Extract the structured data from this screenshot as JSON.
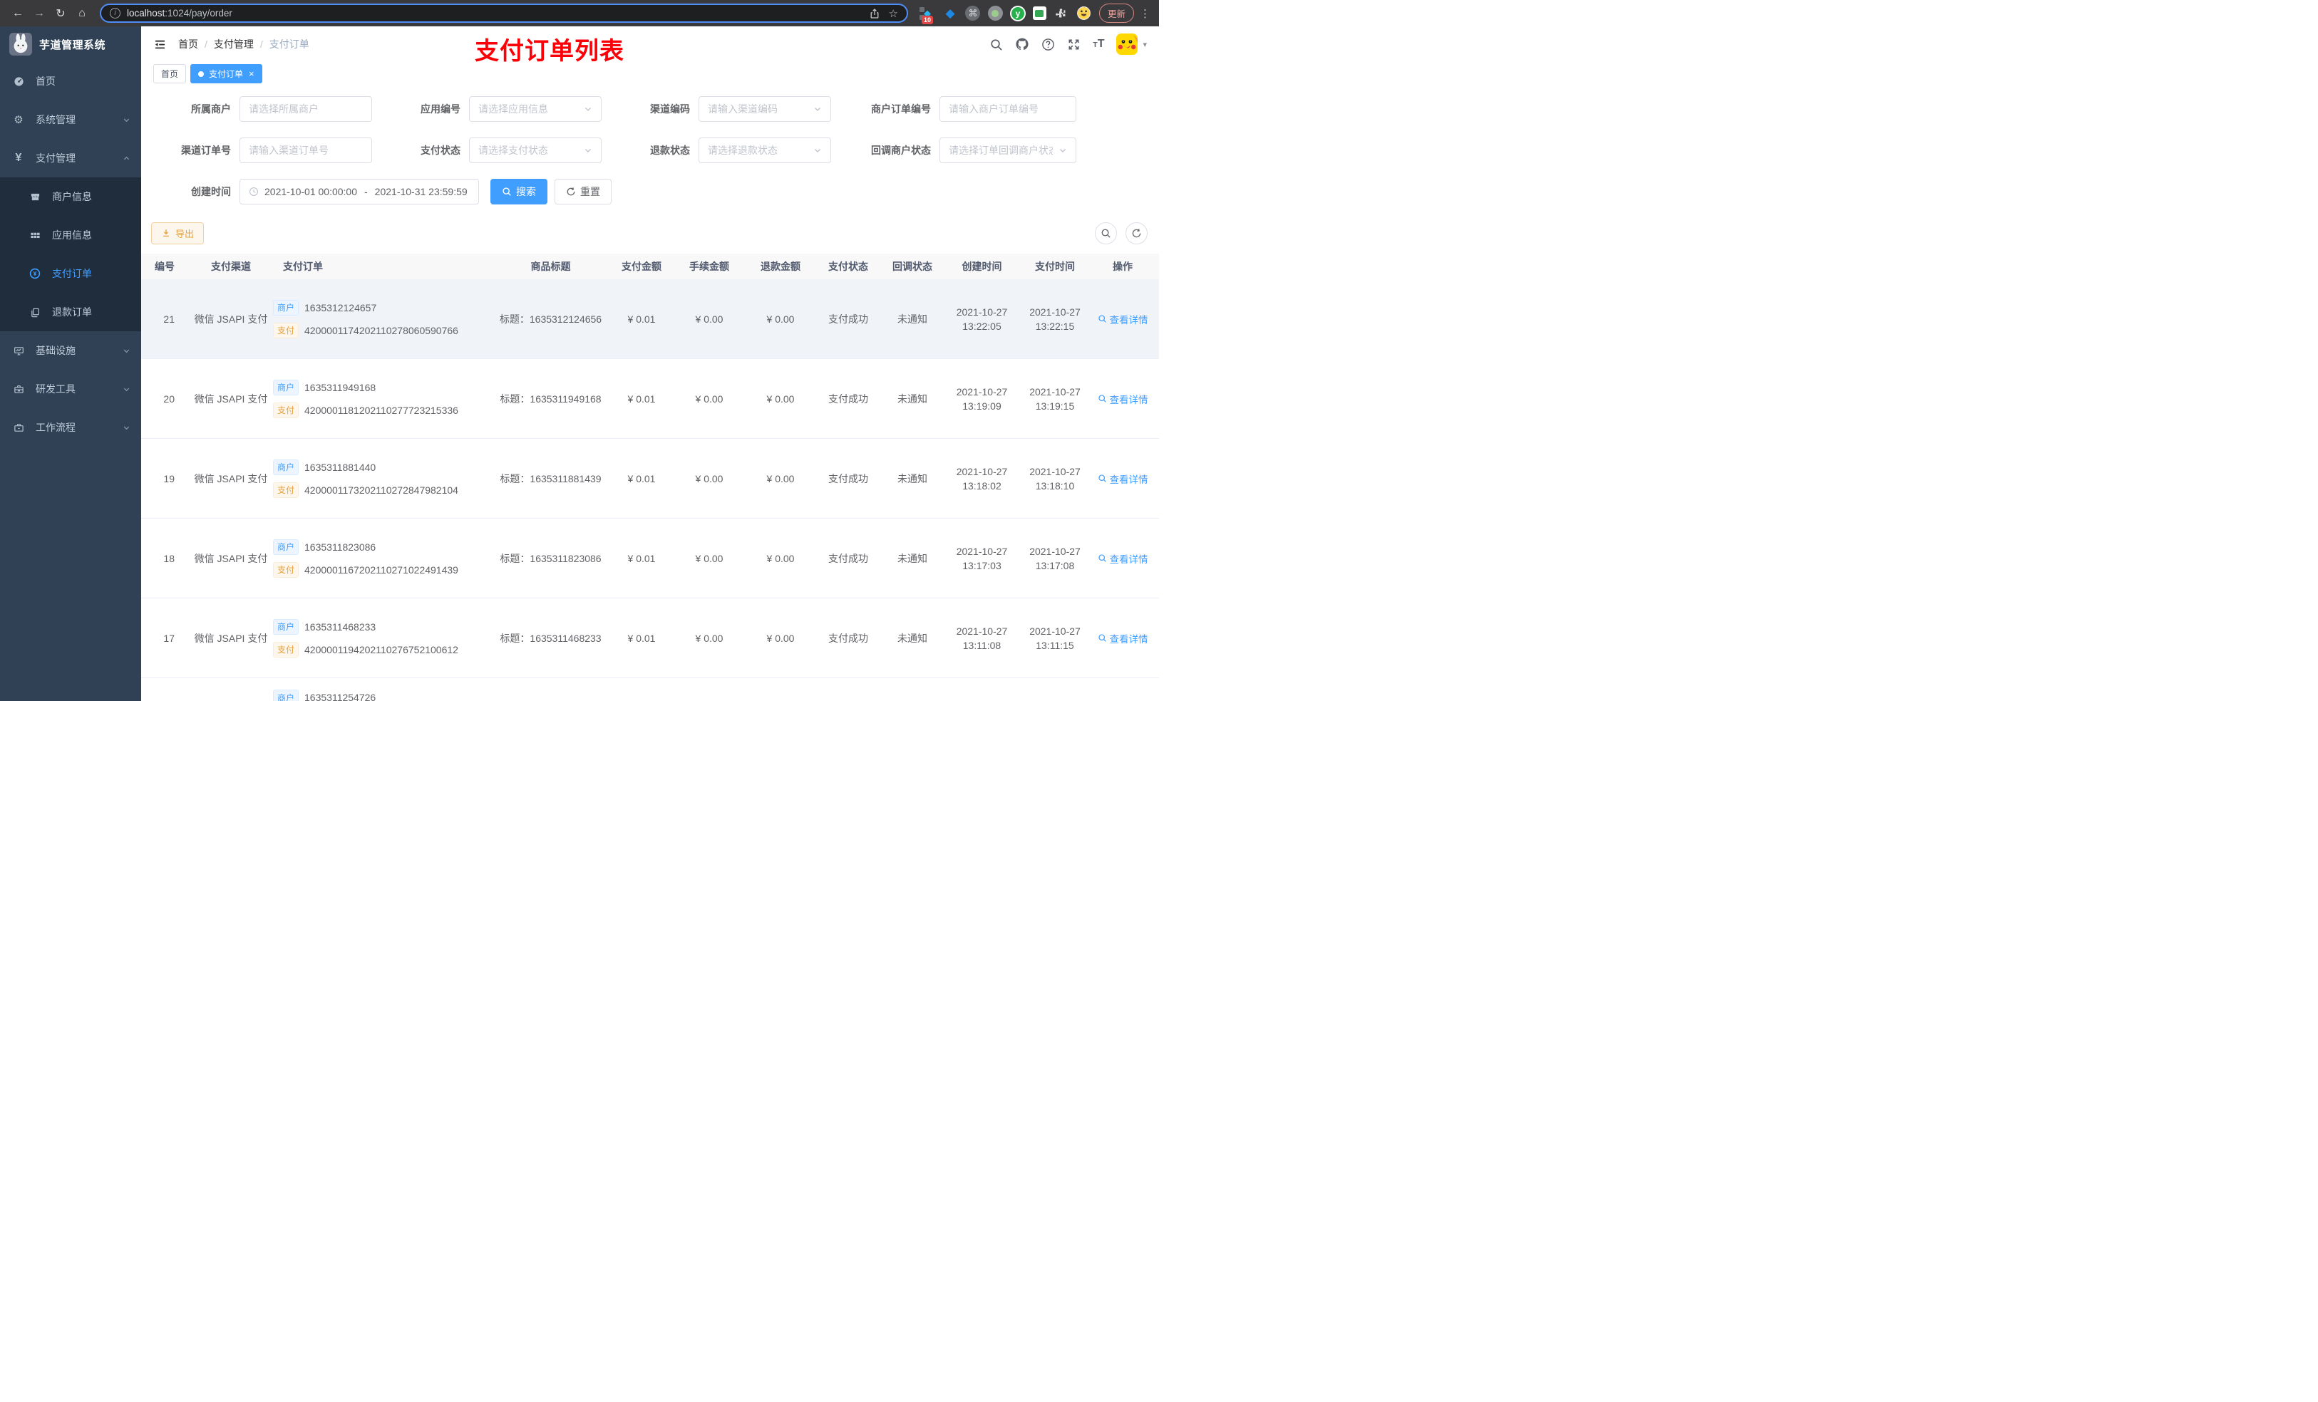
{
  "chrome": {
    "url_host": "localhost",
    "url_path": ":1024/pay/order",
    "ext_badge": "10",
    "update_label": "更新"
  },
  "glyphs": {
    "back": "←",
    "forward": "→",
    "reload": "↻",
    "home": "⌂",
    "info": "i",
    "star": "☆",
    "more": "⋮",
    "cmd": "⌘",
    "ext_y": "y",
    "gear": "⚙",
    "yen": "¥",
    "caret_down": "▾",
    "close": "×",
    "slash": "/",
    "tt_small": "T",
    "tt_big": "T"
  },
  "colors": {
    "accent": "#409eff",
    "sidebar_bg": "#304156",
    "submenu_bg": "#1f2d3d",
    "annotation_red": "#fb0007",
    "warning": "#e6a23c"
  },
  "sidebar": {
    "app_title": "芋道管理系统",
    "items": [
      {
        "label": "首页"
      },
      {
        "label": "系统管理"
      },
      {
        "label": "支付管理"
      },
      {
        "label": "商户信息"
      },
      {
        "label": "应用信息"
      },
      {
        "label": "支付订单"
      },
      {
        "label": "退款订单"
      },
      {
        "label": "基础设施"
      },
      {
        "label": "研发工具"
      },
      {
        "label": "工作流程"
      }
    ]
  },
  "header": {
    "breadcrumb": {
      "home": "首页",
      "section": "支付管理",
      "current": "支付订单",
      "separator": "/"
    },
    "annotation": "支付订单列表"
  },
  "tabs": {
    "home": "首页",
    "current": "支付订单"
  },
  "filters": {
    "merchant": {
      "label": "所属商户",
      "placeholder": "请选择所属商户"
    },
    "app": {
      "label": "应用编号",
      "placeholder": "请选择应用信息"
    },
    "channel_code": {
      "label": "渠道编码",
      "placeholder": "请输入渠道编码"
    },
    "merchant_order_no": {
      "label": "商户订单编号",
      "placeholder": "请输入商户订单编号"
    },
    "channel_order_no": {
      "label": "渠道订单号",
      "placeholder": "请输入渠道订单号"
    },
    "pay_status": {
      "label": "支付状态",
      "placeholder": "请选择支付状态"
    },
    "refund_status": {
      "label": "退款状态",
      "placeholder": "请选择退款状态"
    },
    "notify_status": {
      "label": "回调商户状态",
      "placeholder": "请选择订单回调商户状态"
    },
    "create_time": {
      "label": "创建时间",
      "start": "2021-10-01 00:00:00",
      "separator": "-",
      "end": "2021-10-31 23:59:59"
    },
    "search_label": "搜索",
    "reset_label": "重置"
  },
  "toolbar": {
    "export_label": "导出"
  },
  "table": {
    "columns": {
      "id": "编号",
      "channel": "支付渠道",
      "order": "支付订单",
      "title": "商品标题",
      "amount": "支付金额",
      "fee": "手续金额",
      "refund": "退款金额",
      "status": "支付状态",
      "notify": "回调状态",
      "created": "创建时间",
      "paid": "支付时间",
      "action": "操作"
    },
    "tag_merchant": "商户",
    "tag_pay": "支付",
    "rows": [
      {
        "id": "21",
        "channel": "微信 JSAPI 支付",
        "merchant_no": "1635312124657",
        "pay_no": "4200001174202110278060590766",
        "title": "标题：1635312124656",
        "amount": "¥ 0.01",
        "fee": "¥ 0.00",
        "refund": "¥ 0.00",
        "status": "支付成功",
        "notify": "未通知",
        "created_date": "2021-10-27",
        "created_time": "13:22:05",
        "paid_date": "2021-10-27",
        "paid_time": "13:22:15",
        "action": "查看详情"
      },
      {
        "id": "20",
        "channel": "微信 JSAPI 支付",
        "merchant_no": "1635311949168",
        "pay_no": "4200001181202110277723215336",
        "title": "标题：1635311949168",
        "amount": "¥ 0.01",
        "fee": "¥ 0.00",
        "refund": "¥ 0.00",
        "status": "支付成功",
        "notify": "未通知",
        "created_date": "2021-10-27",
        "created_time": "13:19:09",
        "paid_date": "2021-10-27",
        "paid_time": "13:19:15",
        "action": "查看详情"
      },
      {
        "id": "19",
        "channel": "微信 JSAPI 支付",
        "merchant_no": "1635311881440",
        "pay_no": "4200001173202110272847982104",
        "title": "标题：1635311881439",
        "amount": "¥ 0.01",
        "fee": "¥ 0.00",
        "refund": "¥ 0.00",
        "status": "支付成功",
        "notify": "未通知",
        "created_date": "2021-10-27",
        "created_time": "13:18:02",
        "paid_date": "2021-10-27",
        "paid_time": "13:18:10",
        "action": "查看详情"
      },
      {
        "id": "18",
        "channel": "微信 JSAPI 支付",
        "merchant_no": "1635311823086",
        "pay_no": "4200001167202110271022491439",
        "title": "标题：1635311823086",
        "amount": "¥ 0.01",
        "fee": "¥ 0.00",
        "refund": "¥ 0.00",
        "status": "支付成功",
        "notify": "未通知",
        "created_date": "2021-10-27",
        "created_time": "13:17:03",
        "paid_date": "2021-10-27",
        "paid_time": "13:17:08",
        "action": "查看详情"
      },
      {
        "id": "17",
        "channel": "微信 JSAPI 支付",
        "merchant_no": "1635311468233",
        "pay_no": "4200001194202110276752100612",
        "title": "标题：1635311468233",
        "amount": "¥ 0.01",
        "fee": "¥ 0.00",
        "refund": "¥ 0.00",
        "status": "支付成功",
        "notify": "未通知",
        "created_date": "2021-10-27",
        "created_time": "13:11:08",
        "paid_date": "2021-10-27",
        "paid_time": "13:11:15",
        "action": "查看详情"
      }
    ],
    "partial_row": {
      "merchant_no": "1635311254726"
    }
  }
}
